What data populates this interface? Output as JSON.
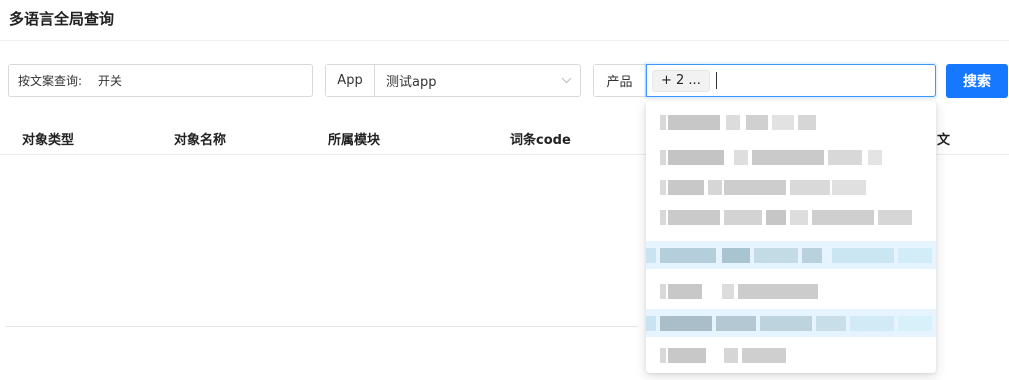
{
  "page": {
    "title": "多语言全局查询"
  },
  "filters": {
    "keyword": {
      "label": "按文案查询:",
      "value": "开关"
    },
    "app": {
      "label": "App",
      "value": "测试app"
    },
    "product": {
      "label": "产品",
      "tag": "+ 2 ..."
    },
    "search_button": "搜索"
  },
  "table": {
    "columns": [
      "对象类型",
      "对象名称",
      "所属模块",
      "词条code",
      "中文"
    ]
  },
  "dropdown": {
    "options": [
      {
        "label": "",
        "selected": false
      },
      {
        "label": "",
        "selected": false
      },
      {
        "label": "",
        "selected": false
      },
      {
        "label": "",
        "selected": false
      },
      {
        "label": "",
        "selected": true
      },
      {
        "label": "",
        "selected": false
      },
      {
        "label": "",
        "selected": true
      },
      {
        "label": "",
        "selected": false
      }
    ]
  },
  "colors": {
    "primary": "#1677ff",
    "selected_bg": "#e6f4ff"
  },
  "icons": {
    "select_arrow": "chevron-down-icon"
  }
}
